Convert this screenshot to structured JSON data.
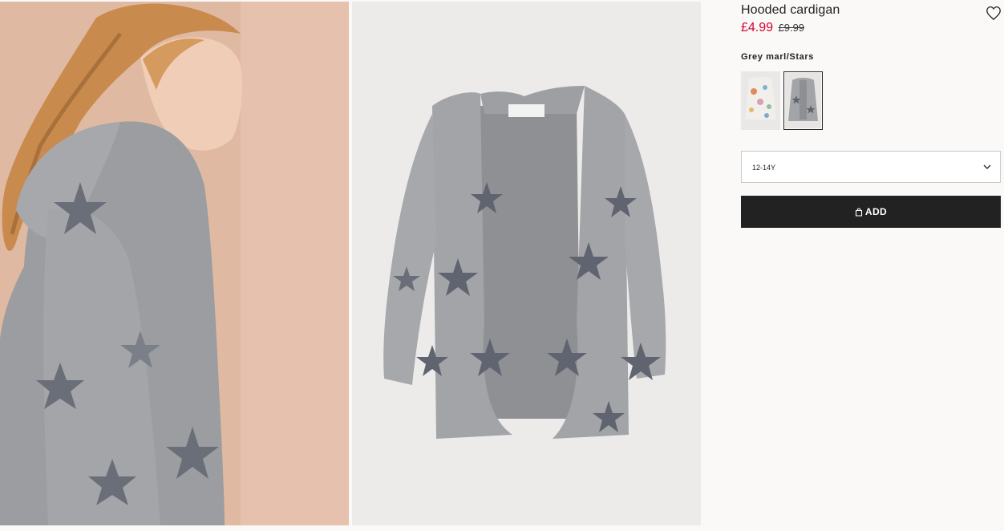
{
  "product": {
    "title": "Hooded cardigan",
    "price_sale": "£4.99",
    "price_old": "£9.99",
    "colour_name": "Grey marl/Stars"
  },
  "swatches": [
    {
      "name": "Floral",
      "selected": false
    },
    {
      "name": "Grey marl/Stars",
      "selected": true
    }
  ],
  "size_select": {
    "value": "12-14Y"
  },
  "add_button": {
    "label": "ADD"
  },
  "icons": {
    "favourite": "heart-icon",
    "dropdown": "chevron-down-icon",
    "bag": "bag-icon"
  },
  "colors": {
    "sale": "#d6002c",
    "button": "#222222",
    "page_bg": "#faf9f8"
  }
}
